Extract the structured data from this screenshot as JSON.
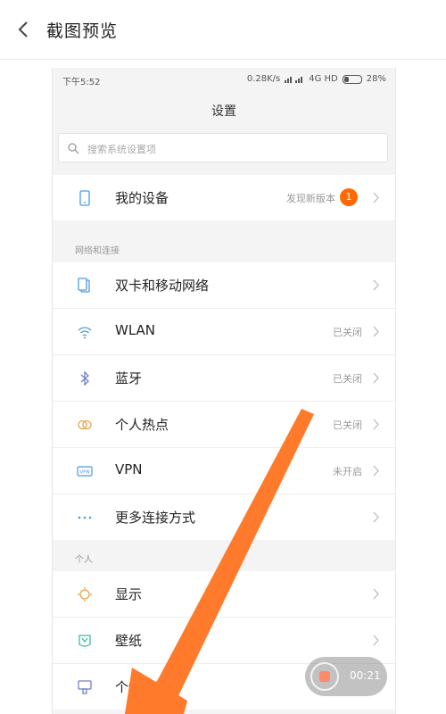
{
  "header": {
    "title": "截图预览",
    "back_icon": "chevron-left-icon"
  },
  "status_bar": {
    "time": "下午5:52",
    "speed": "0.28K/s",
    "network": "4G HD",
    "battery": "28%"
  },
  "settings": {
    "title": "设置",
    "search_placeholder": "搜索系统设置项",
    "my_device": {
      "label": "我的设备",
      "value": "发现新版本",
      "badge": "1"
    },
    "sections": [
      {
        "header": "网络和连接",
        "items": [
          {
            "label": "双卡和移动网络",
            "value": "",
            "icon": "sim-icon"
          },
          {
            "label": "WLAN",
            "value": "已关闭",
            "icon": "wifi-icon"
          },
          {
            "label": "蓝牙",
            "value": "已关闭",
            "icon": "bluetooth-icon"
          },
          {
            "label": "个人热点",
            "value": "已关闭",
            "icon": "hotspot-icon"
          },
          {
            "label": "VPN",
            "value": "未开启",
            "icon": "vpn-icon"
          },
          {
            "label": "更多连接方式",
            "value": "",
            "icon": "more-dots-icon"
          }
        ]
      },
      {
        "header": "个人",
        "items": [
          {
            "label": "显示",
            "value": "",
            "icon": "display-icon"
          },
          {
            "label": "壁纸",
            "value": "",
            "icon": "wallpaper-icon"
          },
          {
            "label": "个性主题",
            "value": "",
            "icon": "theme-icon"
          }
        ]
      }
    ]
  },
  "recording": {
    "timer": "00:21"
  },
  "colors": {
    "accent": "#ff6a00",
    "arrow": "#ff7a2a",
    "icon_blue": "#4a9be0"
  }
}
